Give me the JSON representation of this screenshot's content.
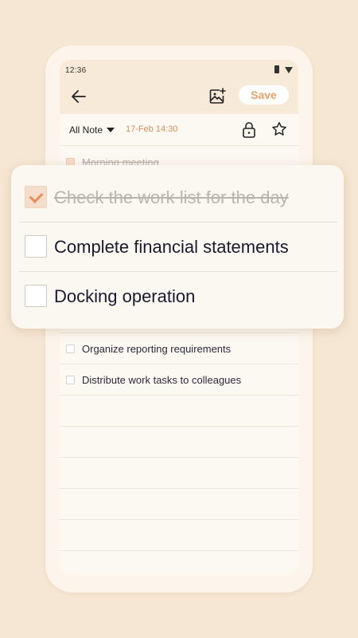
{
  "status": {
    "time": "12:36"
  },
  "toolbar": {
    "save_label": "Save"
  },
  "meta": {
    "folder": "All Note",
    "date": "17-Feb 14:30"
  },
  "list_items": [
    {
      "text": "Morning meeting",
      "checked": true
    },
    {
      "text": "Organize reporting requirements",
      "checked": false
    },
    {
      "text": "Distribute work tasks to colleagues",
      "checked": false
    }
  ],
  "popup_items": [
    {
      "text": "Check the work list for the day",
      "checked": true
    },
    {
      "text": "Complete financial statements",
      "checked": false
    },
    {
      "text": "Docking operation",
      "checked": false
    }
  ],
  "colors": {
    "accent": "#e6a26a",
    "background": "#f6e7d4",
    "check": "#e58e5a"
  }
}
